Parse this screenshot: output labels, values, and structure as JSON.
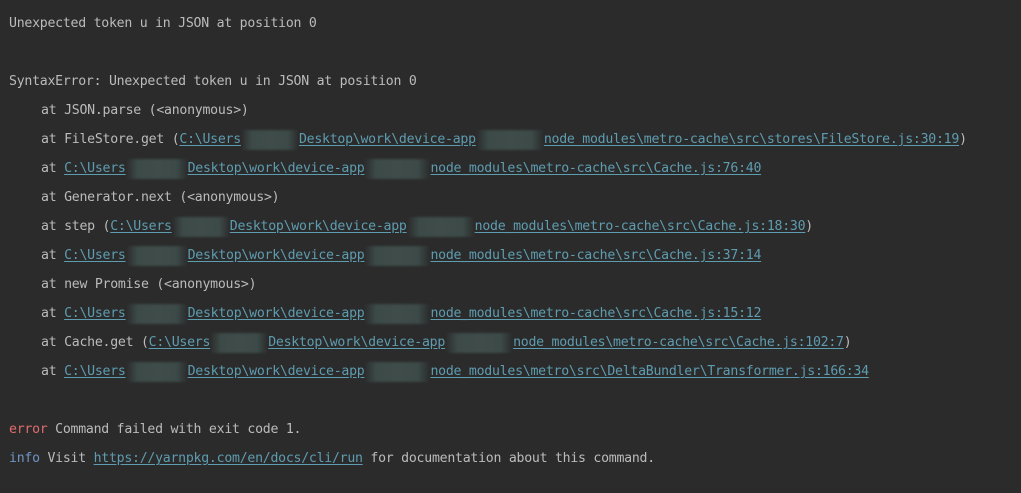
{
  "log": {
    "line1": "Unexpected token u in JSON at position 0",
    "line2": "SyntaxError: Unexpected token u in JSON at position 0",
    "stack": {
      "s1": "at JSON.parse (<anonymous>)",
      "s2_prefix": "at FileStore.get (",
      "s2_link_a": "C:\\Users",
      "s2_link_b": "Desktop\\work\\device-app",
      "s2_link_c": "node_modules\\metro-cache\\src\\stores\\FileStore.js:30:19",
      "s2_suffix": ")",
      "s3_prefix": "at ",
      "s3_link_a": "C:\\Users",
      "s3_link_b": "Desktop\\work\\device-app",
      "s3_link_c": "node_modules\\metro-cache\\src\\Cache.js:76:40",
      "s4": "at Generator.next (<anonymous>)",
      "s5_prefix": "at step (",
      "s5_link_a": "C:\\Users",
      "s5_link_b": "Desktop\\work\\device-app",
      "s5_link_c": "node_modules\\metro-cache\\src\\Cache.js:18:30",
      "s5_suffix": ")",
      "s6_prefix": "at ",
      "s6_link_a": "C:\\Users",
      "s6_link_b": "Desktop\\work\\device-app",
      "s6_link_c": "node_modules\\metro-cache\\src\\Cache.js:37:14",
      "s7": "at new Promise (<anonymous>)",
      "s8_prefix": "at ",
      "s8_link_a": "C:\\Users",
      "s8_link_b": "Desktop\\work\\device-app",
      "s8_link_c": "node_modules\\metro-cache\\src\\Cache.js:15:12",
      "s9_prefix": "at Cache.get (",
      "s9_link_a": "C:\\Users",
      "s9_link_b": "Desktop\\work\\device-app",
      "s9_link_c": "node_modules\\metro-cache\\src\\Cache.js:102:7",
      "s9_suffix": ")",
      "s10_prefix": "at ",
      "s10_link_a": "C:\\Users",
      "s10_link_b": "Desktop\\work\\device-app",
      "s10_link_c": "node_modules\\metro\\src\\DeltaBundler\\Transformer.js:166:34"
    },
    "error_label": "error",
    "error_text": " Command failed with exit code 1.",
    "info_label": "info",
    "info_text_a": " Visit ",
    "info_link": "https://yarnpkg.com/en/docs/cli/run",
    "info_text_b": " for documentation about this command."
  },
  "colors": {
    "background": "#2b2b2b",
    "text": "#bbbbbb",
    "link": "#5e9cb0",
    "error": "#e06c6c",
    "info": "#6f95c6"
  }
}
